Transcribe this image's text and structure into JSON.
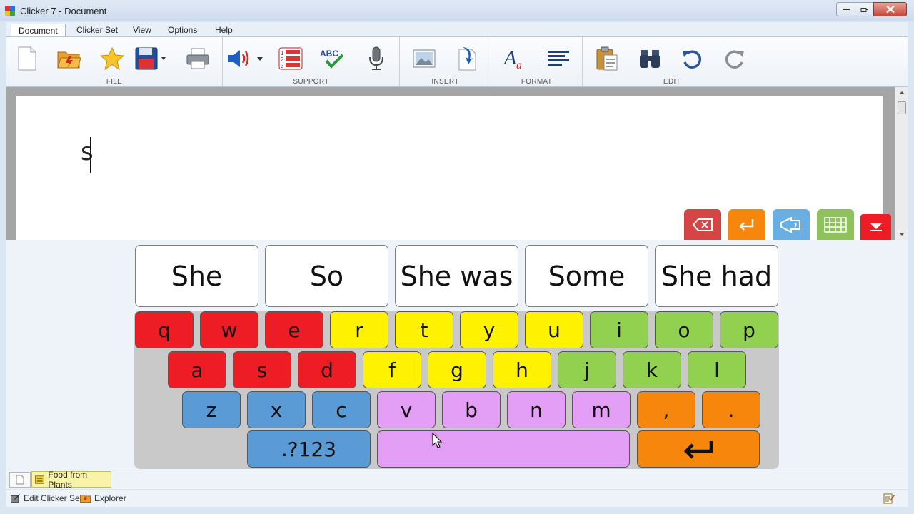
{
  "window": {
    "title": "Clicker 7 - Document",
    "icon": "clicker-app-icon"
  },
  "menu": {
    "tabs": [
      "Document",
      "Clicker Set",
      "View",
      "Options",
      "Help"
    ],
    "active": "Document"
  },
  "ribbon": {
    "groups": [
      {
        "label": "FILE",
        "buttons": [
          "new-document-icon",
          "open-folder-icon",
          "favorite-star-icon",
          "save-disk-icon",
          "print-icon"
        ]
      },
      {
        "label": "SUPPORT",
        "buttons": [
          "speech-volume-icon",
          "word-predictor-icon",
          "spellcheck-icon",
          "microphone-icon"
        ]
      },
      {
        "label": "INSERT",
        "buttons": [
          "insert-picture-icon",
          "insert-file-icon"
        ]
      },
      {
        "label": "FORMAT",
        "buttons": [
          "font-style-icon",
          "align-text-icon"
        ]
      },
      {
        "label": "EDIT",
        "buttons": [
          "paste-icon",
          "find-binoculars-icon",
          "undo-icon",
          "redo-icon"
        ]
      }
    ]
  },
  "document": {
    "text": "s"
  },
  "doc_tools": [
    "backspace-icon",
    "enter-icon",
    "speak-icon",
    "keyboard-grid-icon",
    "collapse-down-icon"
  ],
  "predictions": [
    "She",
    "So",
    "She was",
    "Some",
    "She had"
  ],
  "keyboard": {
    "row1": [
      "q",
      "w",
      "e",
      "r",
      "t",
      "y",
      "u",
      "i",
      "o",
      "p"
    ],
    "row2": [
      "a",
      "s",
      "d",
      "f",
      "g",
      "h",
      "j",
      "k",
      "l"
    ],
    "row3": [
      "z",
      "x",
      "c",
      "v",
      "b",
      "n",
      "m",
      ",",
      "."
    ],
    "numbers_key": ".?123",
    "space_key": "",
    "enter_key": "↵"
  },
  "colors": {
    "red": "#ee1c24",
    "yellow": "#fff200",
    "green": "#92d050",
    "blue": "#5b9bd5",
    "purple": "#e39ef5",
    "orange": "#f7860c"
  },
  "bottom_tabs": {
    "set_name": "Food from Plants"
  },
  "status_bar": {
    "edit_set": "Edit Clicker Set",
    "explorer": "Explorer"
  }
}
